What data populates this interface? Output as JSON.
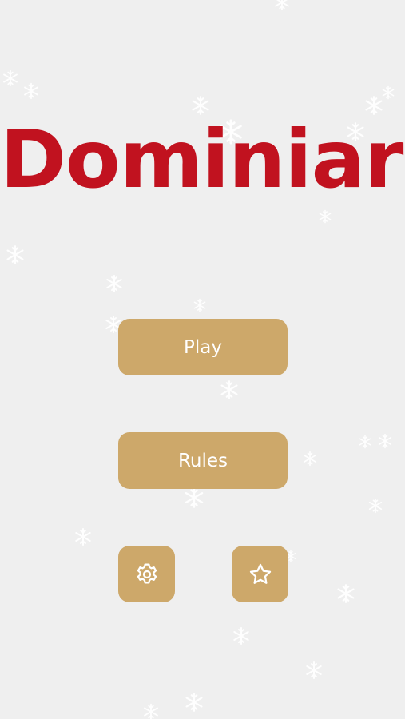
{
  "app": {
    "title": "Dominiard"
  },
  "menu": {
    "play_label": "Play",
    "rules_label": "Rules",
    "settings_icon": "gear-icon",
    "favorite_icon": "star-icon"
  },
  "colors": {
    "background": "#efefef",
    "title": "#c1121f",
    "button": "#cda86a",
    "button_text": "#ffffff",
    "snowflake": "#ffffff"
  },
  "decor": {
    "snowflake_icon": "snowflake-icon"
  }
}
